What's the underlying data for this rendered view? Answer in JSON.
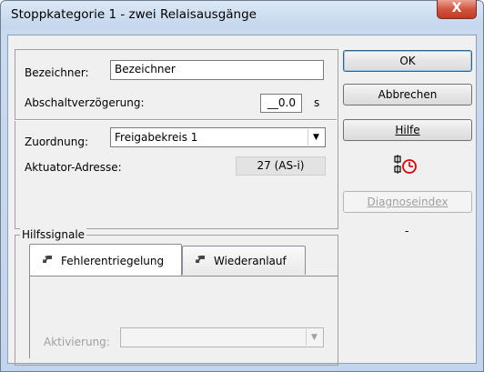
{
  "window": {
    "title": "Stoppkategorie 1 - zwei Relaisausgänge",
    "close_glyph": "X"
  },
  "form": {
    "bezeichner_label": "Bezeichner:",
    "bezeichner_value": "Bezeichner",
    "verzoegerung_label": "Abschaltverzögerung:",
    "verzoegerung_value": "__0.0",
    "verzoegerung_unit": "s",
    "zuordnung_label": "Zuordnung:",
    "zuordnung_value": "Freigabekreis 1",
    "adresse_label": "Aktuator-Adresse:",
    "adresse_value": "27 (AS-i)"
  },
  "buttons": {
    "ok": "OK",
    "abbrechen": "Abbrechen",
    "hilfe": "Hilfe",
    "diagnose": "Diagnoseindex",
    "dash": "-"
  },
  "hilfssignale": {
    "group_label": "Hilfssignale",
    "tabs": [
      {
        "label": "Fehlerentriegelung",
        "active": true
      },
      {
        "label": "Wiederanlauf",
        "active": false
      }
    ],
    "aktivierung_label": "Aktivierung:",
    "aktivierung_value": ""
  },
  "icons": {
    "relay_timer": "relay-timer-icon",
    "tab_icon": "reset-signal-icon"
  }
}
